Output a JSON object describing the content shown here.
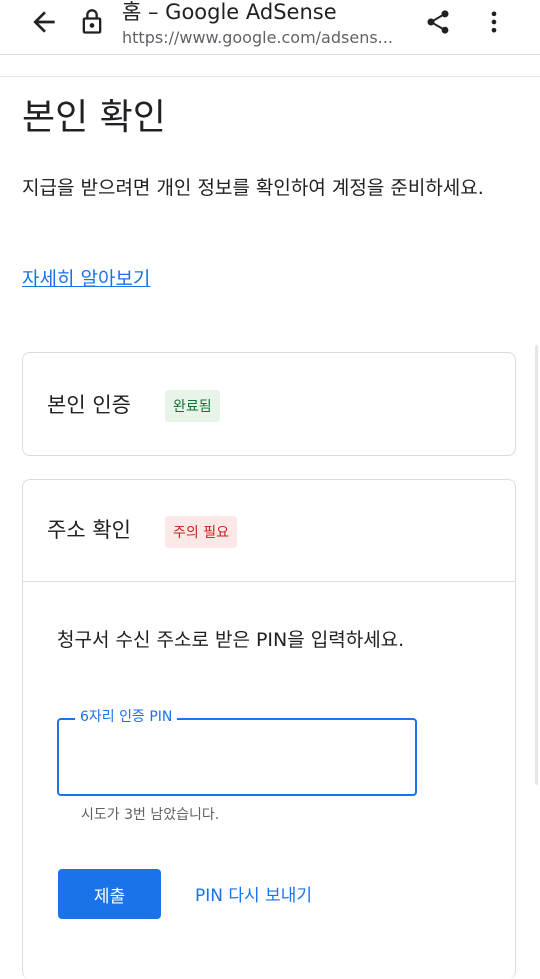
{
  "browser": {
    "tab_title": "홈 – Google AdSense",
    "url": "https://www.google.com/adsens...",
    "icons": [
      "back-arrow-icon",
      "lock-icon",
      "share-icon",
      "more-vert-icon"
    ]
  },
  "page": {
    "title": "본인 확인",
    "description": "지급을 받으려면 개인 정보를 확인하여 계정을 준비하세요.",
    "learn_more": "자세히 알아보기"
  },
  "identity_card": {
    "heading": "본인 인증",
    "status": "완료됨"
  },
  "address_card": {
    "heading": "주소 확인",
    "status": "주의 필요",
    "instruction": "청구서 수신 주소로 받은 PIN을 입력하세요.",
    "pin_label": "6자리 인증 PIN",
    "pin_value": "",
    "attempts_left": "시도가 3번 남았습니다.",
    "submit_label": "제출",
    "resend_label": "PIN 다시 보내기"
  },
  "colors": {
    "accent": "#1a73e8",
    "success_bg": "#e6f4ea",
    "success_text": "#137333",
    "warn_bg": "#fce8e6",
    "warn_text": "#c5221f"
  }
}
